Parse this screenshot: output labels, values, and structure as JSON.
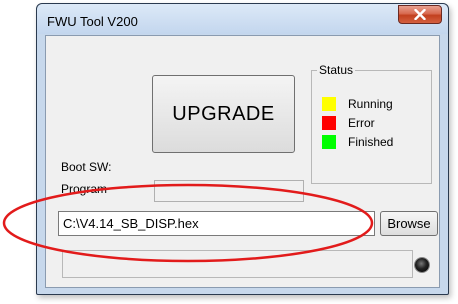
{
  "window": {
    "title": "FWU Tool V200"
  },
  "buttons": {
    "upgrade_label": "UPGRADE",
    "browse_label": "Browse"
  },
  "status": {
    "legend": "Status",
    "items": [
      {
        "label": "Running",
        "color": "#ffff00"
      },
      {
        "label": "Error",
        "color": "#ff0000"
      },
      {
        "label": "Finished",
        "color": "#00ff00"
      }
    ]
  },
  "labels": {
    "boot_sw": "Boot SW:",
    "program": "Program"
  },
  "file": {
    "path": "C:\\V4.14_SB_DISP.hex"
  },
  "annotation": {
    "color": "#e21b1b"
  }
}
